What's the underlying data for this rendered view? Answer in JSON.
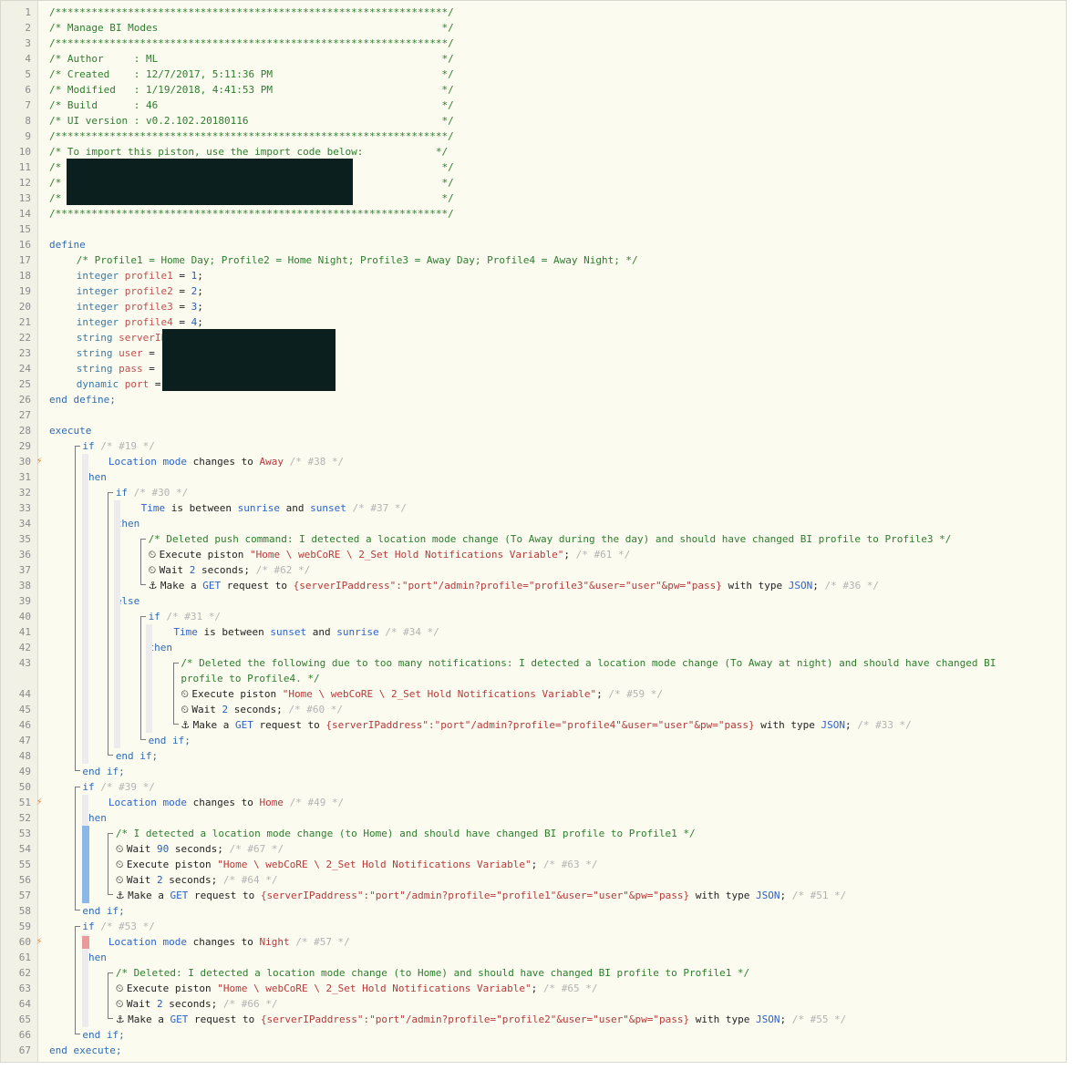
{
  "editor": {
    "line_numbers": [
      "1",
      "2",
      "3",
      "4",
      "5",
      "6",
      "7",
      "8",
      "9",
      "10",
      "11",
      "12",
      "13",
      "14",
      "15",
      "16",
      "17",
      "18",
      "19",
      "20",
      "21",
      "22",
      "23",
      "24",
      "25",
      "26",
      "27",
      "28",
      "29",
      "30",
      "31",
      "32",
      "33",
      "34",
      "35",
      "36",
      "37",
      "38",
      "39",
      "40",
      "41",
      "42",
      "43",
      "44",
      "45",
      "46",
      "47",
      "48",
      "49",
      "50",
      "51",
      "52",
      "53",
      "54",
      "55",
      "56",
      "57",
      "58",
      "59",
      "60",
      "61",
      "62",
      "63",
      "64",
      "65",
      "66",
      "67"
    ],
    "trigger_icon": "⚡",
    "lines": {
      "l1": "/*****************************************************************/",
      "l2": "/* Manage BI Modes                                               */",
      "l3": "/*****************************************************************/",
      "l4": "/* Author     : ML                                               */",
      "l5": "/* Created    : 12/7/2017, 5:11:36 PM                            */",
      "l6": "/* Modified   : 1/19/2018, 4:41:53 PM                            */",
      "l7": "/* Build      : 46                                               */",
      "l8": "/* UI version : v0.2.102.20180116                                */",
      "l9": "/*****************************************************************/",
      "l10": "/* To import this piston, use the import code below:            */",
      "l11": "/*                                                               */",
      "l12": "/*                                                               */",
      "l13": "/*                                                               */",
      "l14": "/*****************************************************************/",
      "l16": "define",
      "l17": "/* Profile1 = Home Day; Profile2 = Home Night; Profile3 = Away Day; Profile4 = Away Night; */",
      "l18_type": "integer",
      "l18_var": "profile1",
      "l18_eq": " = ",
      "l18_val": "1",
      "l18_end": ";",
      "l19_type": "integer",
      "l19_var": "profile2",
      "l19_eq": " = ",
      "l19_val": "2",
      "l19_end": ";",
      "l20_type": "integer",
      "l20_var": "profile3",
      "l20_eq": " = ",
      "l20_val": "3",
      "l20_end": ";",
      "l21_type": "integer",
      "l21_var": "profile4",
      "l21_eq": " = ",
      "l21_val": "4",
      "l21_end": ";",
      "l22_type": "string",
      "l22_var": "serverIP",
      "l23_type": "string",
      "l23_var": "user",
      "l23_eq": " = ",
      "l24_type": "string",
      "l24_var": "pass",
      "l24_eq": " = ",
      "l25_type": "dynamic",
      "l25_var": "port",
      "l25_eq": " = ",
      "l26": "end define;",
      "l28": "execute",
      "l29_kw": "if",
      "l29_c": " /* #19 */",
      "l30_a": "Location mode",
      "l30_b": " changes to ",
      "l30_c": "Away",
      "l30_d": " /* #38 */",
      "l31": "then",
      "l32_kw": "if",
      "l32_c": " /* #30 */",
      "l33_a": "Time",
      "l33_b": " is between ",
      "l33_c": "sunrise",
      "l33_d": " and ",
      "l33_e": "sunset",
      "l33_f": " /* #37 */",
      "l34": "then",
      "l35": "/* Deleted push command: I detected a location mode change (To Away during the day) and should have changed BI profile to Profile3 */",
      "l36_a": "Execute piston ",
      "l36_b": "\"Home \\ webCoRE \\ 2_Set Hold Notifications Variable\"",
      "l36_c": ";",
      "l36_d": " /* #61 */",
      "l37_a": "Wait ",
      "l37_b": "2",
      "l37_c": " seconds;",
      "l37_d": " /* #62 */",
      "l38_a": "Make a ",
      "l38_b": "GET",
      "l38_c": " request to ",
      "l38_d": "{serverIPaddress\":\"port\"/admin?profile=\"profile3\"&user=\"user\"&pw=\"pass}",
      "l38_e": " with type ",
      "l38_f": "JSON",
      "l38_g": ";",
      "l38_h": " /* #36 */",
      "l39": "else",
      "l40_kw": "if",
      "l40_c": " /* #31 */",
      "l41_a": "Time",
      "l41_b": " is between ",
      "l41_c": "sunset",
      "l41_d": " and ",
      "l41_e": "sunrise",
      "l41_f": " /* #34 */",
      "l42": "then",
      "l43": "/* Deleted the following due to too many notifications: I detected a location mode change (To Away at night) and should have changed BI",
      "l43b": "profile to Profile4. */",
      "l44_a": "Execute piston ",
      "l44_b": "\"Home \\ webCoRE \\ 2_Set Hold Notifications Variable\"",
      "l44_c": ";",
      "l44_d": " /* #59 */",
      "l45_a": "Wait ",
      "l45_b": "2",
      "l45_c": " seconds;",
      "l45_d": " /* #60 */",
      "l46_a": "Make a ",
      "l46_b": "GET",
      "l46_c": " request to ",
      "l46_d": "{serverIPaddress\":\"port\"/admin?profile=\"profile4\"&user=\"user\"&pw=\"pass}",
      "l46_e": " with type ",
      "l46_f": "JSON",
      "l46_g": ";",
      "l46_h": " /* #33 */",
      "l47": "end if;",
      "l48": "end if;",
      "l49": "end if;",
      "l50_kw": "if",
      "l50_c": " /* #39 */",
      "l51_a": "Location mode",
      "l51_b": " changes to ",
      "l51_c": "Home",
      "l51_d": " /* #49 */",
      "l52": "then",
      "l53": "/* I detected a location mode change (to Home) and should have changed BI profile to Profile1 */",
      "l54_a": "Wait ",
      "l54_b": "90",
      "l54_c": " seconds;",
      "l54_d": " /* #67 */",
      "l55_a": "Execute piston ",
      "l55_b": "\"Home \\ webCoRE \\ 2_Set Hold Notifications Variable\"",
      "l55_c": ";",
      "l55_d": " /* #63 */",
      "l56_a": "Wait ",
      "l56_b": "2",
      "l56_c": " seconds;",
      "l56_d": " /* #64 */",
      "l57_a": "Make a ",
      "l57_b": "GET",
      "l57_c": " request to ",
      "l57_d": "{serverIPaddress\":\"port\"/admin?profile=\"profile1\"&user=\"user\"&pw=\"pass}",
      "l57_e": " with type ",
      "l57_f": "JSON",
      "l57_g": ";",
      "l57_h": " /* #51 */",
      "l58": "end if;",
      "l59_kw": "if",
      "l59_c": " /* #53 */",
      "l60_a": "Location mode",
      "l60_b": " changes to ",
      "l60_c": "Night",
      "l60_d": " /* #57 */",
      "l61": "then",
      "l62": "/* Deleted: I detected a location mode change (to Home) and should have changed BI profile to Profile1 */",
      "l63_a": "Execute piston ",
      "l63_b": "\"Home \\ webCoRE \\ 2_Set Hold Notifications Variable\"",
      "l63_c": ";",
      "l63_d": " /* #65 */",
      "l64_a": "Wait ",
      "l64_b": "2",
      "l64_c": " seconds;",
      "l64_d": " /* #66 */",
      "l65_a": "Make a ",
      "l65_b": "GET",
      "l65_c": " request to ",
      "l65_d": "{serverIPaddress\":\"port\"/admin?profile=\"profile2\"&user=\"user\"&pw=\"pass}",
      "l65_e": " with type ",
      "l65_f": "JSON",
      "l65_g": ";",
      "l65_h": " /* #55 */",
      "l66": "end if;",
      "l67": "end execute;"
    }
  }
}
